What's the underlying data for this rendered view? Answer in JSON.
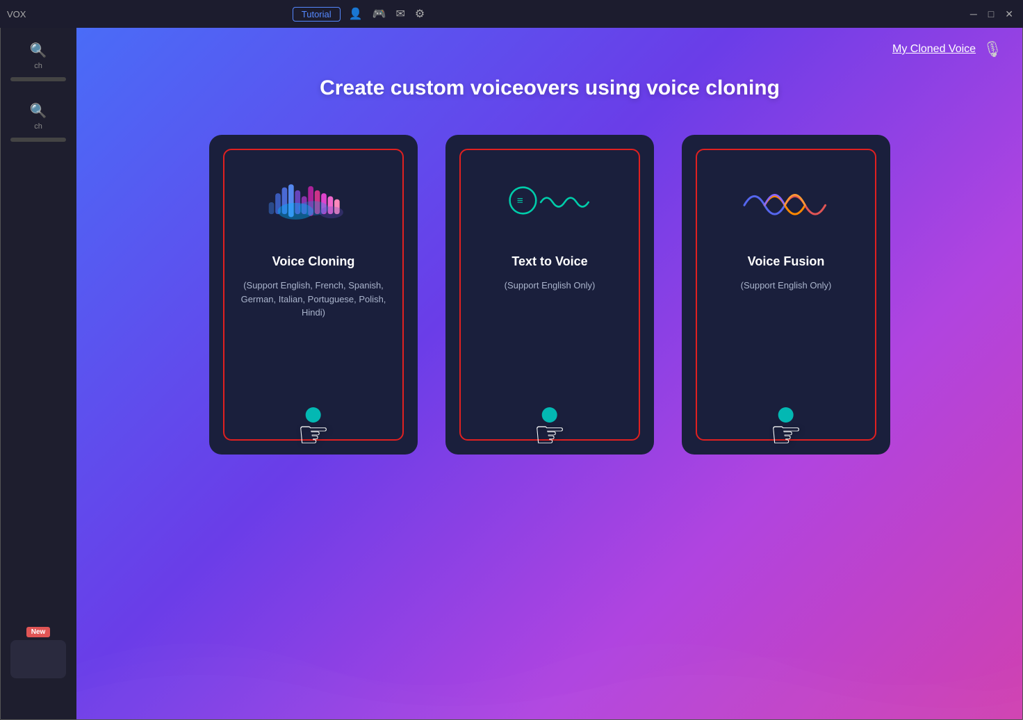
{
  "app": {
    "title": "VOX"
  },
  "titlebar": {
    "tutorial_label": "Tutorial",
    "icons": [
      "user",
      "game",
      "mail",
      "settings"
    ],
    "window_controls": [
      "minimize",
      "maximize",
      "close"
    ]
  },
  "sidebar": {
    "search_label": "ch",
    "search_label2": "ch",
    "new_badge": "New"
  },
  "header": {
    "my_cloned_voice": "My Cloned Voice"
  },
  "main": {
    "heading": "Create custom voiceovers using voice cloning",
    "cards": [
      {
        "id": "voice-cloning",
        "title": "Voice Cloning",
        "subtitle": "(Support English, French, Spanish, German, Italian, Portuguese, Polish, Hindi)"
      },
      {
        "id": "text-to-voice",
        "title": "Text to Voice",
        "subtitle": "(Support English Only)"
      },
      {
        "id": "voice-fusion",
        "title": "Voice Fusion",
        "subtitle": "(Support English Only)"
      }
    ]
  },
  "colors": {
    "accent_red": "#e02020",
    "accent_teal": "#00d4c8",
    "card_bg": "#1a1f3c",
    "gradient_start": "#4a6cf7",
    "gradient_end": "#d040b0"
  }
}
